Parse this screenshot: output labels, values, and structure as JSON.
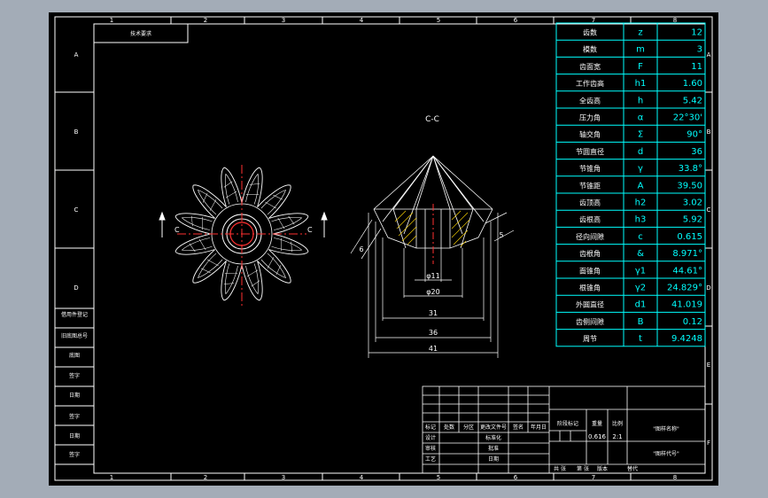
{
  "drawing": {
    "col_numbers": [
      "1",
      "2",
      "3",
      "4",
      "5",
      "6",
      "7",
      "8"
    ],
    "row_letters_left": [
      "A",
      "B",
      "C",
      "D"
    ],
    "row_letters_right": [
      "A",
      "B",
      "C",
      "D",
      "E",
      "F"
    ],
    "top_left_note": "技术要求",
    "section_title": "C-C",
    "section_markers": [
      "C",
      "C"
    ]
  },
  "dimensions": {
    "d11": "φ11",
    "d20": "φ20",
    "w31": "31",
    "w36": "36",
    "w41": "41",
    "a6": "6",
    "a5": "5"
  },
  "params": {
    "rows": [
      {
        "name": "齿数",
        "sym": "z",
        "val": "12"
      },
      {
        "name": "模数",
        "sym": "m",
        "val": "3"
      },
      {
        "name": "齿面宽",
        "sym": "F",
        "val": "11"
      },
      {
        "name": "工作齿高",
        "sym": "h1",
        "val": "1.60"
      },
      {
        "name": "全齿高",
        "sym": "h",
        "val": "5.42"
      },
      {
        "name": "压力角",
        "sym": "α",
        "val": "22°30'"
      },
      {
        "name": "轴交角",
        "sym": "Σ",
        "val": "90°"
      },
      {
        "name": "节圆直径",
        "sym": "d",
        "val": "36"
      },
      {
        "name": "节锥角",
        "sym": "γ",
        "val": "33.8°"
      },
      {
        "name": "节锥距",
        "sym": "A",
        "val": "39.50"
      },
      {
        "name": "齿顶高",
        "sym": "h2",
        "val": "3.02"
      },
      {
        "name": "齿根高",
        "sym": "h3",
        "val": "5.92"
      },
      {
        "name": "径向间隙",
        "sym": "c",
        "val": "0.615"
      },
      {
        "name": "齿根角",
        "sym": "&",
        "val": "8.971°"
      },
      {
        "name": "面锥角",
        "sym": "γ1",
        "val": "44.61°"
      },
      {
        "name": "根锥角",
        "sym": "γ2",
        "val": "24.829°"
      },
      {
        "name": "外圆直径",
        "sym": "d1",
        "val": "41.019"
      },
      {
        "name": "齿侧间隙",
        "sym": "B",
        "val": "0.12"
      },
      {
        "name": "周节",
        "sym": "t",
        "val": "9.4248"
      }
    ]
  },
  "left_strip": {
    "labels": [
      "借用件登记",
      "旧底图总号",
      "底图",
      "签字",
      "日期"
    ]
  },
  "title_block": {
    "rev_headers": [
      "标记",
      "处数",
      "分区",
      "更改文件号",
      "签名",
      "年月日"
    ],
    "role_labels": [
      "设计",
      "审核",
      "工艺"
    ],
    "mid_labels": [
      "标准化",
      "批准",
      "日期"
    ],
    "stage_label": "阶段标记",
    "weight_label": "重量",
    "scale_label": "比例",
    "weight_value": "0.616",
    "scale_value": "2:1",
    "bottom_labels": [
      "共 张",
      "第 张",
      "版本",
      "替代"
    ],
    "part_name": "\"图样名称\"",
    "part_code": "\"图样代号\""
  },
  "colors": {
    "background": "#a3acb7",
    "paper": "#000000",
    "frame": "#ffffff",
    "table": "#00ffff",
    "center_line": "#ff0000",
    "hatch": "#ffff00"
  }
}
